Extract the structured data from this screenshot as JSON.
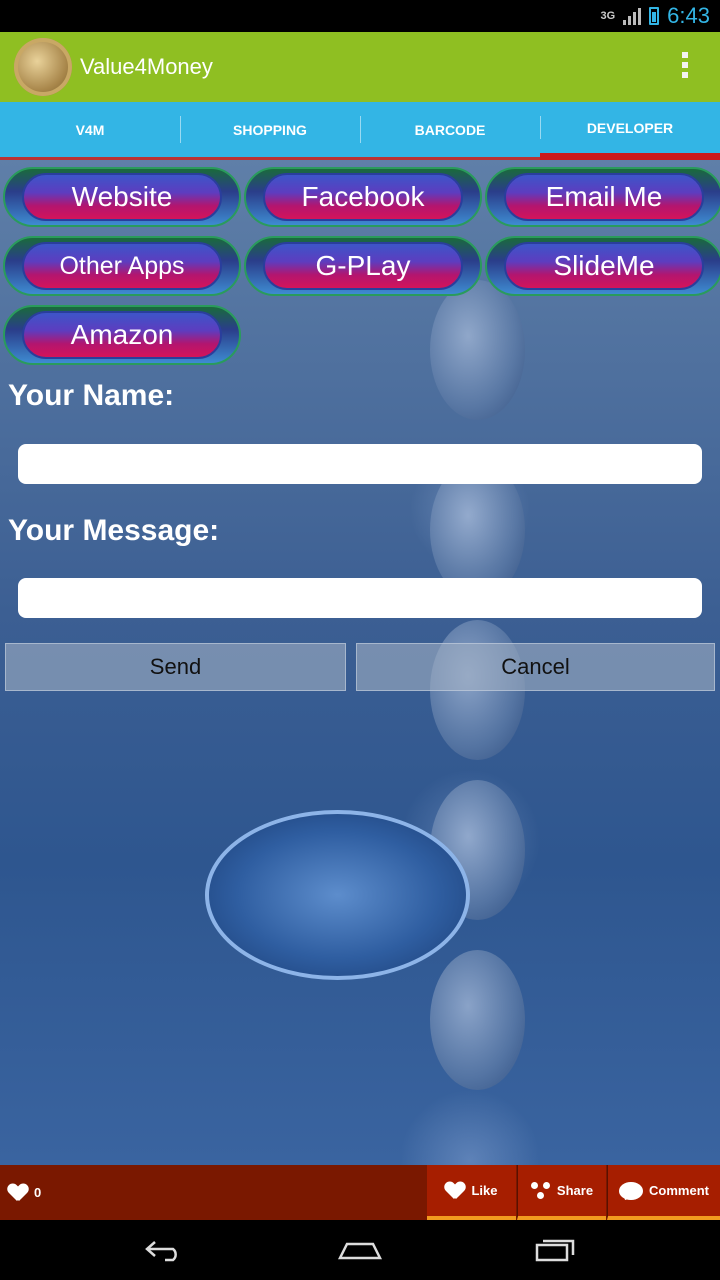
{
  "status_bar": {
    "network": "3G",
    "time": "6:43"
  },
  "app": {
    "title": "Value4Money"
  },
  "tabs": [
    {
      "label": "V4M"
    },
    {
      "label": "SHOPPING"
    },
    {
      "label": "BARCODE"
    },
    {
      "label": "DEVELOPER"
    }
  ],
  "links": [
    {
      "label": "Website"
    },
    {
      "label": "Facebook"
    },
    {
      "label": "Email Me"
    },
    {
      "label": "Other Apps"
    },
    {
      "label": "G-PLay"
    },
    {
      "label": "SlideMe"
    },
    {
      "label": "Amazon"
    }
  ],
  "form": {
    "name_label": "Your Name:",
    "name_value": "",
    "message_label": "Your Message:",
    "message_value": "",
    "send_label": "Send",
    "cancel_label": "Cancel"
  },
  "social": {
    "like_count": "0",
    "like_label": "Like",
    "share_label": "Share",
    "comment_label": "Comment"
  },
  "colors": {
    "action_bar": "#8fbf22",
    "tabs": "#33b5e5",
    "active_tab_indicator": "#cc1a1a",
    "social_bar": "#7a1800"
  }
}
